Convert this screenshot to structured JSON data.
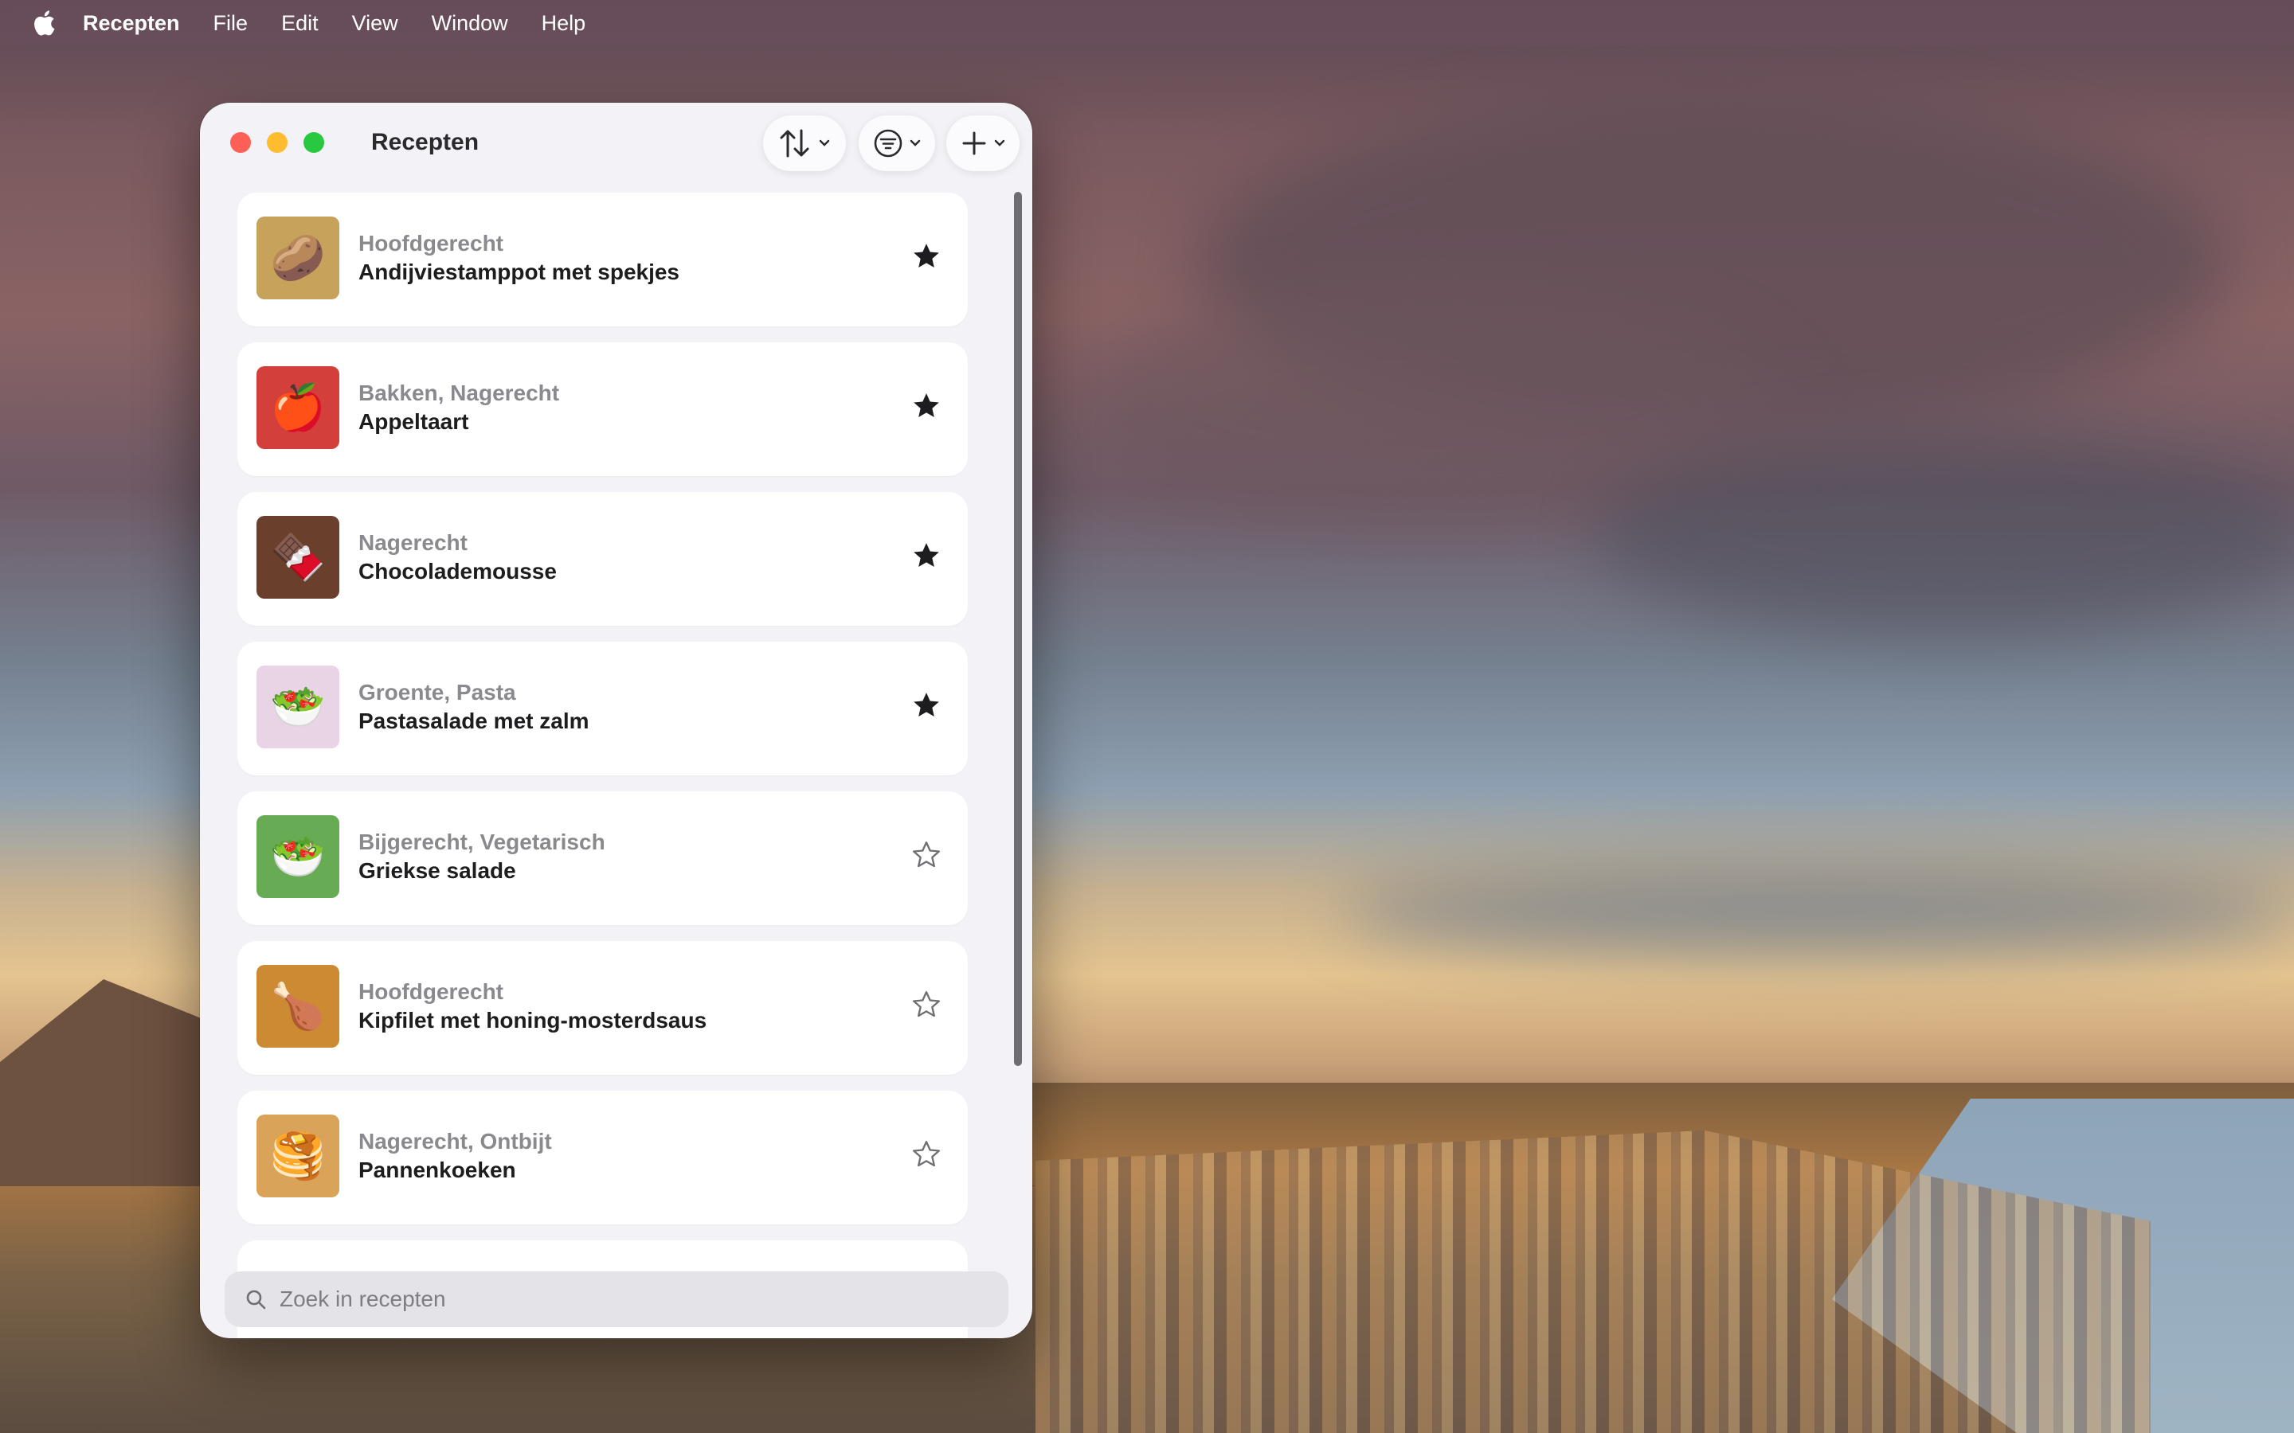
{
  "menubar": {
    "app_name": "Recepten",
    "items": [
      "File",
      "Edit",
      "View",
      "Window",
      "Help"
    ]
  },
  "window": {
    "title": "Recepten",
    "toolbar": {
      "sort_icon": "sort-arrows-icon",
      "filter_icon": "filter-lines-icon",
      "add_icon": "plus-icon"
    }
  },
  "recipes": [
    {
      "category": "Hoofdgerecht",
      "name": "Andijviestamppot met spekjes",
      "favorite": true,
      "emoji": "🥔",
      "color": "#c7a25a"
    },
    {
      "category": "Bakken, Nagerecht",
      "name": "Appeltaart",
      "favorite": true,
      "emoji": "🍎",
      "color": "#d3403b"
    },
    {
      "category": "Nagerecht",
      "name": "Chocolademousse",
      "favorite": true,
      "emoji": "🍫",
      "color": "#6a3f2c"
    },
    {
      "category": "Groente, Pasta",
      "name": "Pastasalade met zalm",
      "favorite": true,
      "emoji": "🥗",
      "color": "#e9d4e6"
    },
    {
      "category": "Bijgerecht, Vegetarisch",
      "name": "Griekse salade",
      "favorite": false,
      "emoji": "🥗",
      "color": "#68ab55"
    },
    {
      "category": "Hoofdgerecht",
      "name": "Kipfilet met honing-mosterdsaus",
      "favorite": false,
      "emoji": "🍗",
      "color": "#cc8a33"
    },
    {
      "category": "Nagerecht, Ontbijt",
      "name": "Pannenkoeken",
      "favorite": false,
      "emoji": "🥞",
      "color": "#d9a45a"
    }
  ],
  "search": {
    "placeholder": "Zoek in recepten",
    "value": ""
  },
  "colors": {
    "star": "#1d1d1f",
    "close": "#fe5f57",
    "minimize": "#febc2e",
    "maximize": "#28c840"
  }
}
